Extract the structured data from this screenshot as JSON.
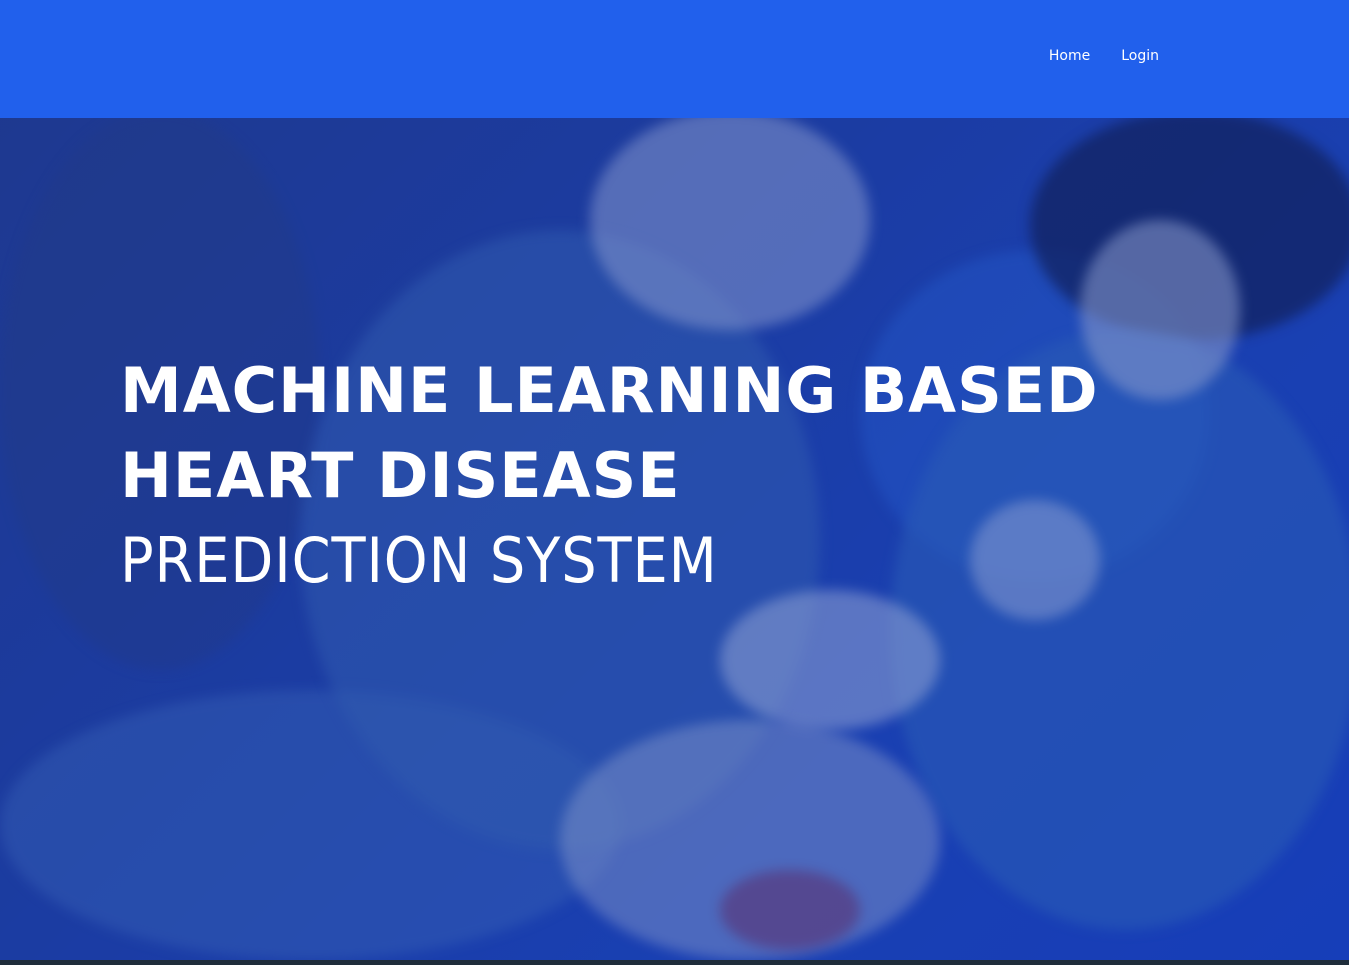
{
  "nav": {
    "items": [
      {
        "label": "Home"
      },
      {
        "label": "Login"
      }
    ]
  },
  "hero": {
    "line1": "MACHINE LEARNING BASED",
    "line2": "HEART DISEASE",
    "line3": "PREDICTION SYSTEM"
  },
  "colors": {
    "navbar": "#2160ec",
    "text": "#ffffff",
    "overlay": "#1d3fa8"
  }
}
